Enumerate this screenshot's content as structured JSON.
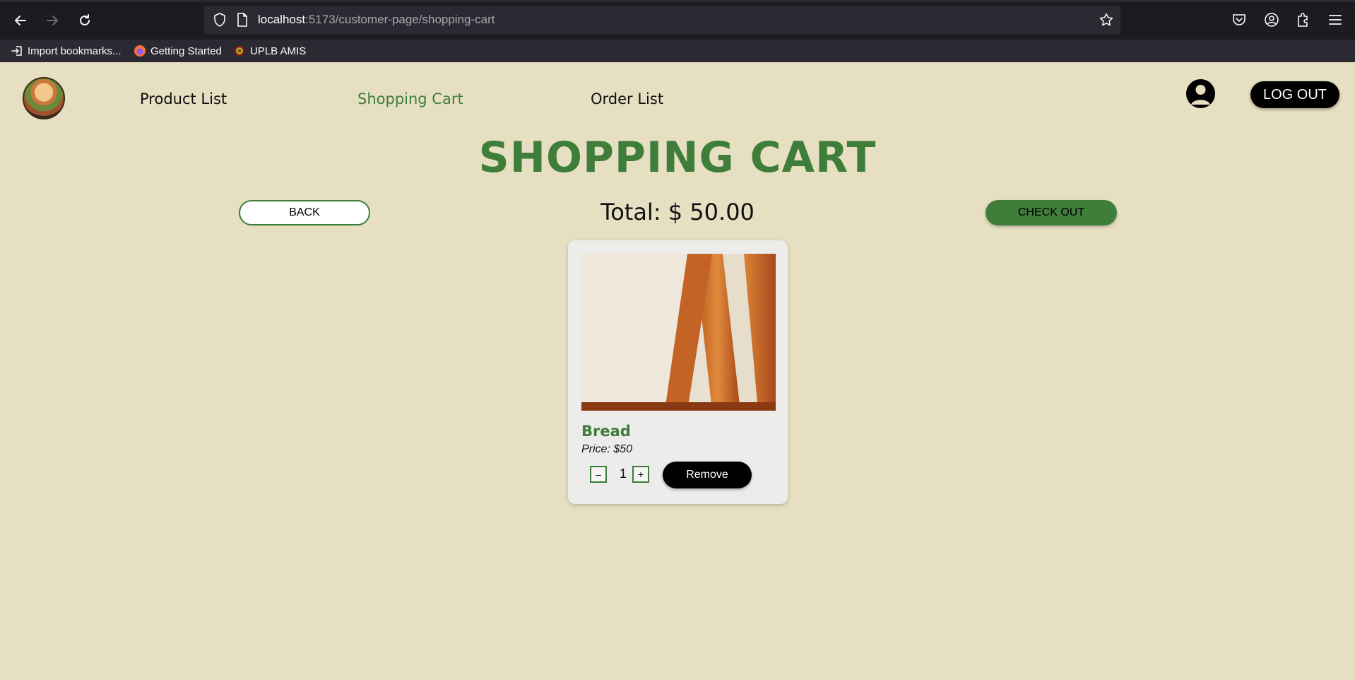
{
  "browser": {
    "url_host": "localhost",
    "url_path": ":5173/customer-page/shopping-cart",
    "bookmarks": [
      {
        "label": "Import bookmarks...",
        "icon": "import-icon"
      },
      {
        "label": "Getting Started",
        "icon": "firefox-icon"
      },
      {
        "label": "UPLB AMIS",
        "icon": "uplb-seal-icon"
      }
    ]
  },
  "nav": {
    "links": [
      "Product List",
      "Shopping Cart",
      "Order List"
    ],
    "active": "Shopping Cart",
    "logout_label": "LOG OUT"
  },
  "page": {
    "title": "SHOPPING CART",
    "back_label": "BACK",
    "total_label": "Total: $ 50.00",
    "checkout_label": "CHECK OUT"
  },
  "cart": {
    "items": [
      {
        "name": "Bread",
        "price_label": "Price: $50",
        "quantity": "1",
        "minus_label": "–",
        "plus_label": "+",
        "remove_label": "Remove"
      }
    ]
  },
  "colors": {
    "background": "#e6dfc2",
    "accent_green": "#3f7d3a",
    "card": "#ececea"
  }
}
